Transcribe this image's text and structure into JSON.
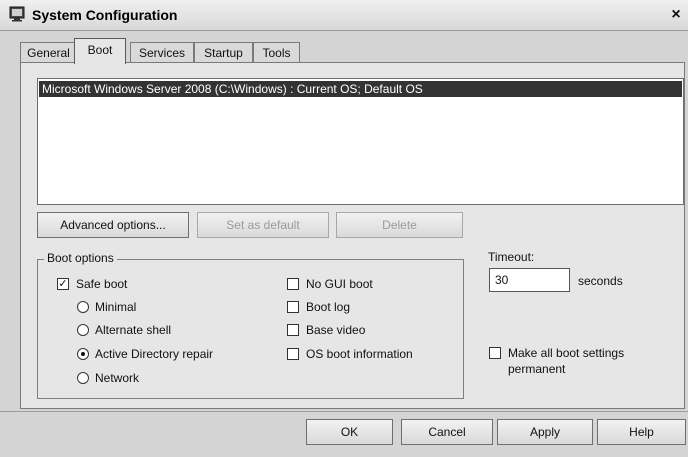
{
  "window": {
    "title": "System Configuration",
    "close_symbol": "×",
    "icons": {
      "app": "msconfig-icon",
      "close": "close-icon"
    }
  },
  "tabs": [
    {
      "label": "General",
      "active": false
    },
    {
      "label": "Boot",
      "active": true
    },
    {
      "label": "Services",
      "active": false
    },
    {
      "label": "Startup",
      "active": false
    },
    {
      "label": "Tools",
      "active": false
    }
  ],
  "boot_list": {
    "items": [
      {
        "label": "Microsoft Windows Server 2008 (C:\\Windows) : Current OS; Default OS",
        "selected": true
      }
    ]
  },
  "list_buttons": {
    "advanced": {
      "label": "Advanced options...",
      "enabled": true
    },
    "set_default": {
      "label": "Set as default",
      "enabled": false
    },
    "delete": {
      "label": "Delete",
      "enabled": false
    }
  },
  "boot_options": {
    "legend": "Boot options",
    "safe_boot": {
      "label": "Safe boot",
      "checked": true
    },
    "safe_modes": [
      {
        "label": "Minimal",
        "selected": false
      },
      {
        "label": "Alternate shell",
        "selected": false
      },
      {
        "label": "Active Directory repair",
        "selected": true
      },
      {
        "label": "Network",
        "selected": false
      }
    ],
    "checks": [
      {
        "label": "No GUI boot",
        "checked": false
      },
      {
        "label": "Boot log",
        "checked": false
      },
      {
        "label": "Base video",
        "checked": false
      },
      {
        "label": "OS boot information",
        "checked": false
      }
    ]
  },
  "timeout": {
    "label": "Timeout:",
    "value": "30",
    "unit": "seconds"
  },
  "permanent": {
    "label_line1": "Make all boot settings",
    "label_line2": "permanent",
    "checked": false
  },
  "dialog_buttons": {
    "ok": "OK",
    "cancel": "Cancel",
    "apply": "Apply",
    "help": "Help"
  },
  "colors": {
    "selection": "#333333",
    "dialog_bg": "#e6e6e6",
    "window_bg": "#d4d4d4"
  }
}
